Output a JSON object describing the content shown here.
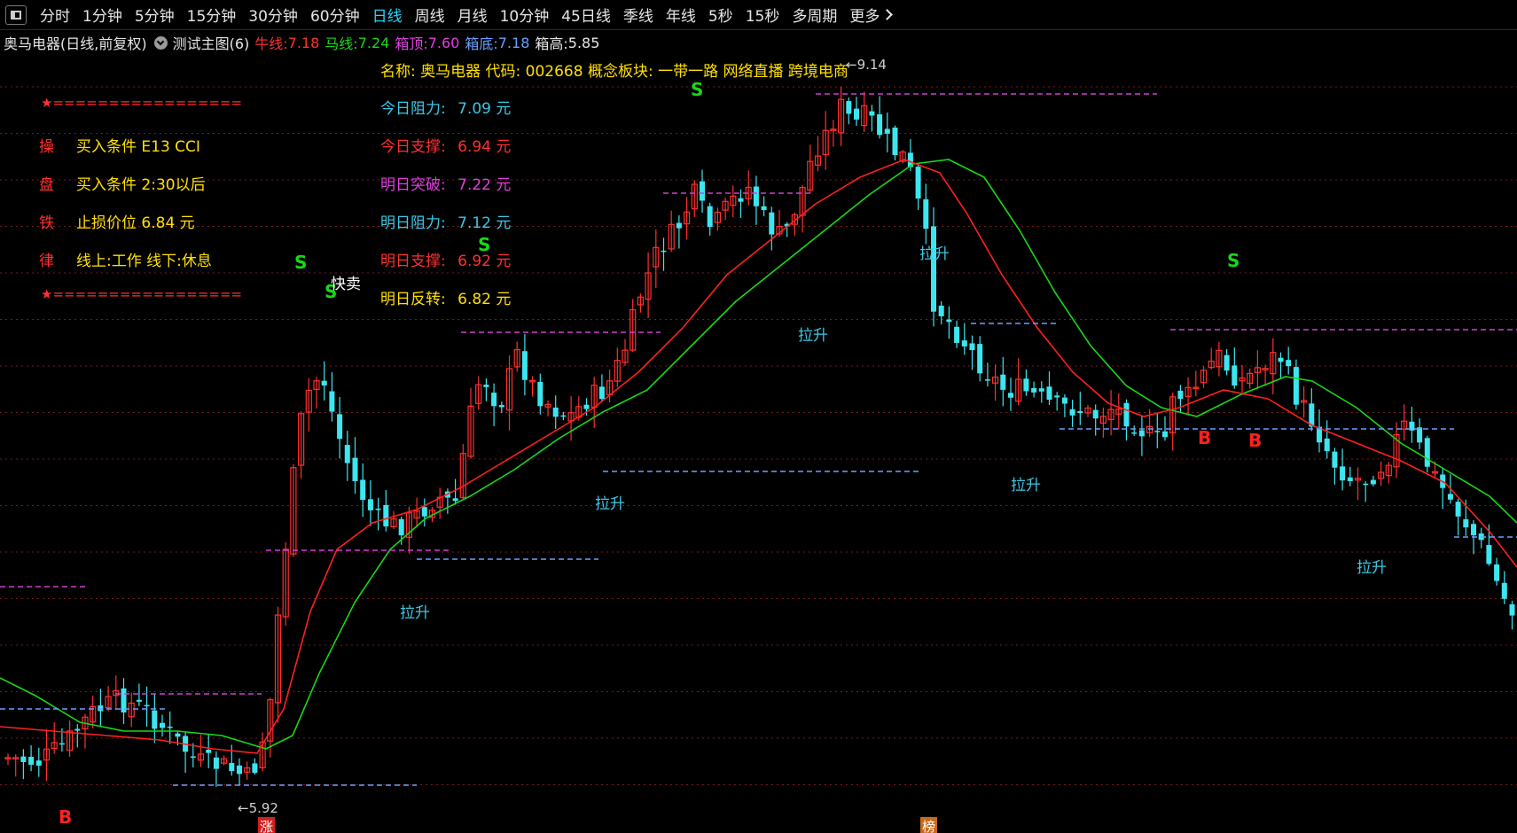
{
  "toolbar": {
    "periods": [
      "分时",
      "1分钟",
      "5分钟",
      "15分钟",
      "30分钟",
      "60分钟",
      "日线",
      "周线",
      "月线",
      "10分钟",
      "45日线",
      "季线",
      "年线",
      "5秒",
      "15秒",
      "多周期"
    ],
    "active_period": "日线",
    "more_label": "更多"
  },
  "indicator_bar": {
    "stock_title": "奥马电器(日线,前复权)",
    "template_name": "测试主图(6)",
    "niu_label": "牛线:",
    "niu_value": "7.18",
    "ma_label": "马线:",
    "ma_value": "7.24",
    "box_top_label": "箱顶:",
    "box_top_value": "7.60",
    "box_bottom_label": "箱底:",
    "box_bottom_value": "7.18",
    "box_height_label": "箱高:",
    "box_height_value": "5.85"
  },
  "info_line": "名称: 奥马电器 代码: 002668 概念板块: 一带一路 网络直播 跨境电商",
  "rules": {
    "divider": "=================",
    "rows": [
      {
        "tag": "操",
        "text": "买入条件 E13 CCI"
      },
      {
        "tag": "盘",
        "text": "买入条件 2:30以后"
      },
      {
        "tag": "铁",
        "text": "止损价位 6.84 元"
      },
      {
        "tag": "律",
        "text": "线上:工作 线下:休息"
      }
    ]
  },
  "levels": [
    {
      "label": "今日阻力:",
      "value": "7.09 元",
      "color": "#3cc8e6"
    },
    {
      "label": "今日支撑:",
      "value": "6.94 元",
      "color": "#ff3030"
    },
    {
      "label": "明日突破:",
      "value": "7.22 元",
      "color": "#e040e0"
    },
    {
      "label": "明日阻力:",
      "value": "7.12 元",
      "color": "#3cc8e6"
    },
    {
      "label": "明日支撑:",
      "value": "6.92 元",
      "color": "#ff3030"
    },
    {
      "label": "明日反转:",
      "value": "6.82 元",
      "color": "#ffe000"
    }
  ],
  "price_labels": {
    "high": "9.14",
    "low": "5.92"
  },
  "annotations": {
    "s_label": "S",
    "b_label": "B",
    "quick_sell": "快卖",
    "lasheng": "拉升",
    "zhang": "涨",
    "bang": "榜"
  },
  "colors": {
    "background": "#000000",
    "up_candle": "#ff3030",
    "down_candle": "#3ce6f0",
    "niu_line": "#ff2020",
    "ma_line": "#18d818",
    "grid": "#7a1a1a",
    "box_line": "#d040d0",
    "support_line": "#6aa0ff"
  }
}
